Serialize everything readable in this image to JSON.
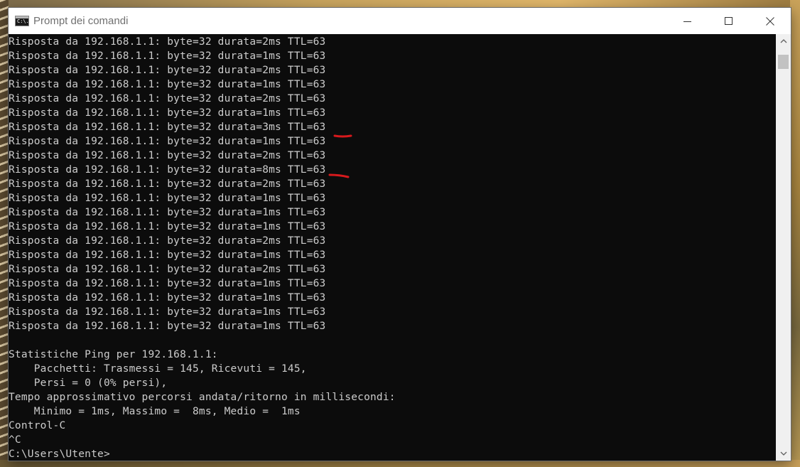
{
  "window": {
    "title": "Prompt dei comandi",
    "icon_label": "C:\\.",
    "controls": {
      "minimize": "minimize-icon",
      "maximize": "maximize-icon",
      "close": "close-icon"
    }
  },
  "console": {
    "lines": [
      "Risposta da 192.168.1.1: byte=32 durata=2ms TTL=63",
      "Risposta da 192.168.1.1: byte=32 durata=1ms TTL=63",
      "Risposta da 192.168.1.1: byte=32 durata=2ms TTL=63",
      "Risposta da 192.168.1.1: byte=32 durata=1ms TTL=63",
      "Risposta da 192.168.1.1: byte=32 durata=2ms TTL=63",
      "Risposta da 192.168.1.1: byte=32 durata=1ms TTL=63",
      "Risposta da 192.168.1.1: byte=32 durata=3ms TTL=63",
      "Risposta da 192.168.1.1: byte=32 durata=1ms TTL=63",
      "Risposta da 192.168.1.1: byte=32 durata=2ms TTL=63",
      "Risposta da 192.168.1.1: byte=32 durata=8ms TTL=63",
      "Risposta da 192.168.1.1: byte=32 durata=2ms TTL=63",
      "Risposta da 192.168.1.1: byte=32 durata=1ms TTL=63",
      "Risposta da 192.168.1.1: byte=32 durata=1ms TTL=63",
      "Risposta da 192.168.1.1: byte=32 durata=1ms TTL=63",
      "Risposta da 192.168.1.1: byte=32 durata=2ms TTL=63",
      "Risposta da 192.168.1.1: byte=32 durata=1ms TTL=63",
      "Risposta da 192.168.1.1: byte=32 durata=2ms TTL=63",
      "Risposta da 192.168.1.1: byte=32 durata=1ms TTL=63",
      "Risposta da 192.168.1.1: byte=32 durata=1ms TTL=63",
      "Risposta da 192.168.1.1: byte=32 durata=1ms TTL=63",
      "Risposta da 192.168.1.1: byte=32 durata=1ms TTL=63",
      "",
      "Statistiche Ping per 192.168.1.1:",
      "    Pacchetti: Trasmessi = 145, Ricevuti = 145,",
      "    Persi = 0 (0% persi),",
      "Tempo approssimativo percorsi andata/ritorno in millisecondi:",
      "    Minimo = 1ms, Massimo =  8ms, Medio =  1ms",
      "Control-C",
      "^C",
      "C:\\Users\\Utente>"
    ],
    "text_color": "#CCCCCC",
    "background_color": "#0C0C0C",
    "annotation_color": "#D7191C"
  },
  "scrollbar": {
    "up_icon": "chevron-up-icon",
    "down_icon": "chevron-down-icon"
  }
}
